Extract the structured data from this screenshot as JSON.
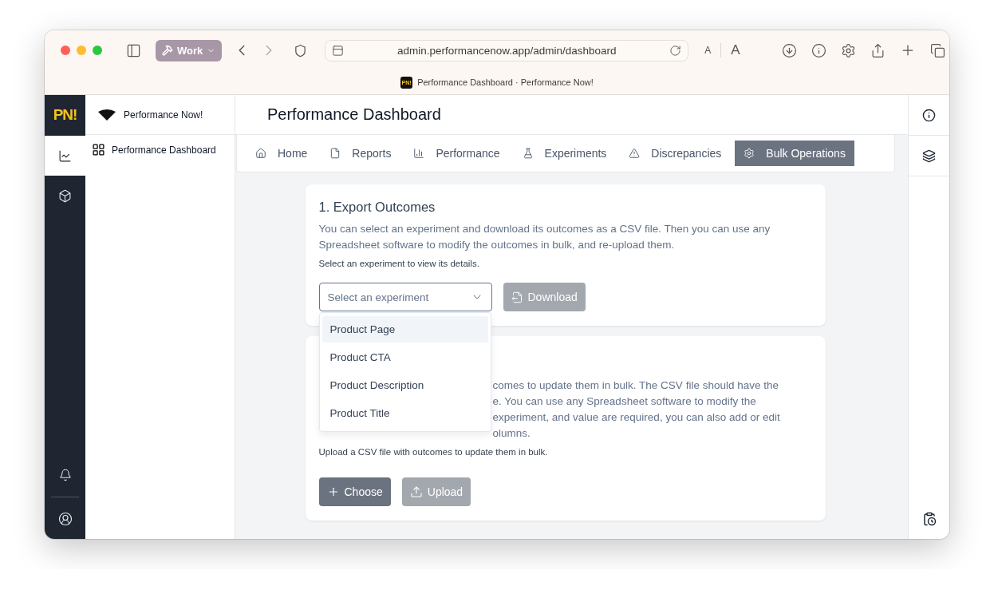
{
  "browser": {
    "profile": "Work",
    "url": "admin.performancenow.app/admin/dashboard",
    "text_smaller": "A",
    "text_larger": "A",
    "favicon": "PN!",
    "tab_title": "Performance Dashboard · Performance Now!"
  },
  "rail": {
    "logo": "PN!",
    "items": [
      {
        "selected": true
      },
      {
        "selected": false
      }
    ]
  },
  "sidebar": {
    "brand": "Performance Now!",
    "items": [
      {
        "label": "Performance Dashboard"
      }
    ]
  },
  "header": {
    "title": "Performance Dashboard"
  },
  "tabs": [
    {
      "label": "Home",
      "selected": false
    },
    {
      "label": "Reports",
      "selected": false
    },
    {
      "label": "Performance",
      "selected": false
    },
    {
      "label": "Experiments",
      "selected": false
    },
    {
      "label": "Discrepancies",
      "selected": false
    },
    {
      "label": "Bulk Operations",
      "selected": true
    }
  ],
  "export_card": {
    "title": "1. Export Outcomes",
    "description": "You can select an experiment and download its outcomes as a CSV file. Then you can use any Spreadsheet software to modify the outcomes in bulk, and re-upload them.",
    "hint": "Select an experiment to view its details.",
    "select": {
      "placeholder": "Select an experiment",
      "expanded": true
    },
    "button": {
      "label": "Download",
      "disabled": true
    }
  },
  "dropdown": {
    "options": [
      {
        "label": "Product Page",
        "selected": true
      },
      {
        "label": "Product CTA",
        "selected": false
      },
      {
        "label": "Product Description",
        "selected": false
      },
      {
        "label": "Product Title",
        "selected": false
      }
    ]
  },
  "import_card": {
    "description_lines": [
      "comes to update them in bulk. The CSV file should have the",
      "e. You can use any Spreadsheet software to modify the",
      "experiment, and value are required, you can also add or edit",
      "olumns."
    ],
    "hint": "Upload a CSV file with outcomes to update them in bulk.",
    "buttons": [
      {
        "label": "Choose",
        "disabled": false
      },
      {
        "label": "Upload",
        "disabled": true
      }
    ]
  }
}
